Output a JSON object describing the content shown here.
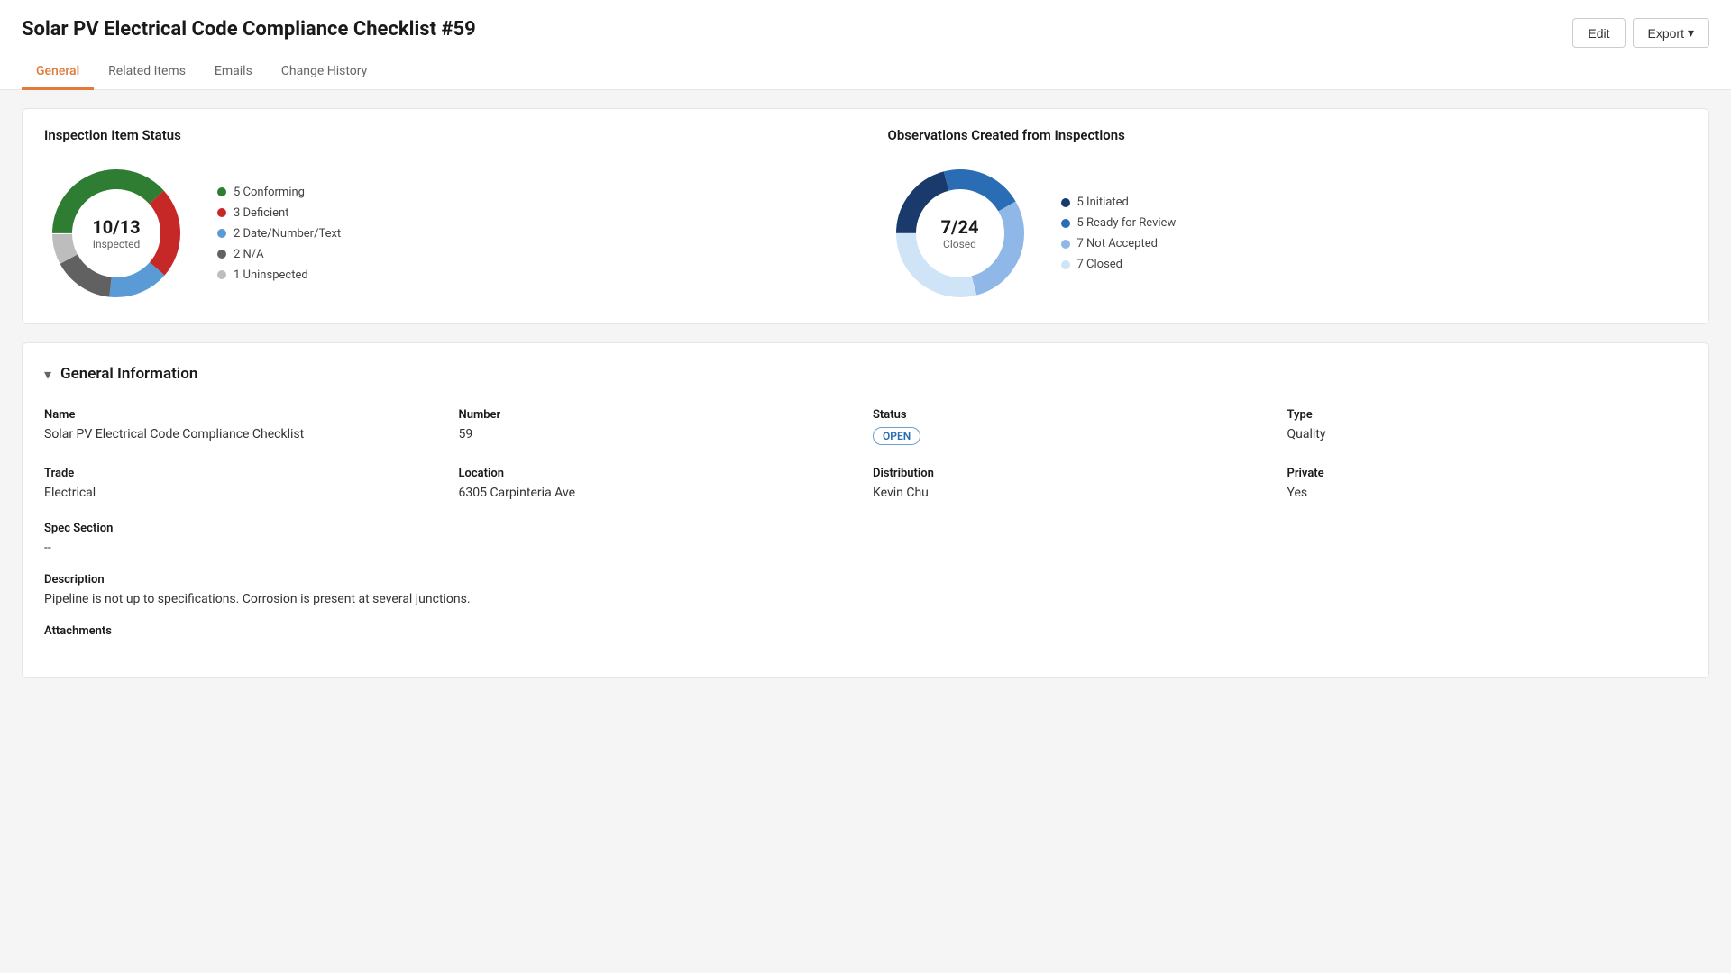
{
  "page": {
    "title": "Solar PV Electrical Code Compliance Checklist #59"
  },
  "header_actions": {
    "edit_label": "Edit",
    "export_label": "Export"
  },
  "tabs": [
    {
      "id": "general",
      "label": "General",
      "active": true
    },
    {
      "id": "related-items",
      "label": "Related Items",
      "active": false
    },
    {
      "id": "emails",
      "label": "Emails",
      "active": false
    },
    {
      "id": "change-history",
      "label": "Change History",
      "active": false
    }
  ],
  "inspection_status": {
    "title": "Inspection Item Status",
    "center_num": "10/13",
    "center_label": "Inspected",
    "legend": [
      {
        "color": "#2e7d32",
        "label": "5 Conforming"
      },
      {
        "color": "#c62828",
        "label": "3 Deficient"
      },
      {
        "color": "#5b9bd5",
        "label": "2 Date/Number/Text"
      },
      {
        "color": "#616161",
        "label": "2 N/A"
      },
      {
        "color": "#bdbdbd",
        "label": "1 Uninspected"
      }
    ],
    "segments": [
      {
        "value": 5,
        "color": "#2e7d32"
      },
      {
        "value": 3,
        "color": "#c62828"
      },
      {
        "value": 2,
        "color": "#5b9bd5"
      },
      {
        "value": 2,
        "color": "#616161"
      },
      {
        "value": 1,
        "color": "#bdbdbd"
      }
    ],
    "total": 13
  },
  "observations": {
    "title": "Observations Created from Inspections",
    "center_num": "7/24",
    "center_label": "Closed",
    "legend": [
      {
        "color": "#1a3a6b",
        "label": "5 Initiated"
      },
      {
        "color": "#2a6db5",
        "label": "5 Ready for Review"
      },
      {
        "color": "#8fb8e8",
        "label": "7 Not Accepted"
      },
      {
        "color": "#d0e4f7",
        "label": "7 Closed"
      }
    ],
    "segments": [
      {
        "value": 5,
        "color": "#1a3a6b"
      },
      {
        "value": 5,
        "color": "#2a6db5"
      },
      {
        "value": 7,
        "color": "#8fb8e8"
      },
      {
        "value": 7,
        "color": "#d0e4f7"
      }
    ],
    "total": 24
  },
  "general_info": {
    "section_title": "General Information",
    "fields": {
      "name_label": "Name",
      "name_value": "Solar PV Electrical Code Compliance Checklist",
      "number_label": "Number",
      "number_value": "59",
      "status_label": "Status",
      "status_value": "OPEN",
      "type_label": "Type",
      "type_value": "Quality",
      "trade_label": "Trade",
      "trade_value": "Electrical",
      "location_label": "Location",
      "location_value": "6305 Carpinteria Ave",
      "distribution_label": "Distribution",
      "distribution_value": "Kevin Chu",
      "private_label": "Private",
      "private_value": "Yes",
      "spec_section_label": "Spec Section",
      "spec_section_value": "--",
      "description_label": "Description",
      "description_value": "Pipeline is not up to specifications. Corrosion is present at several junctions.",
      "attachments_label": "Attachments"
    }
  }
}
